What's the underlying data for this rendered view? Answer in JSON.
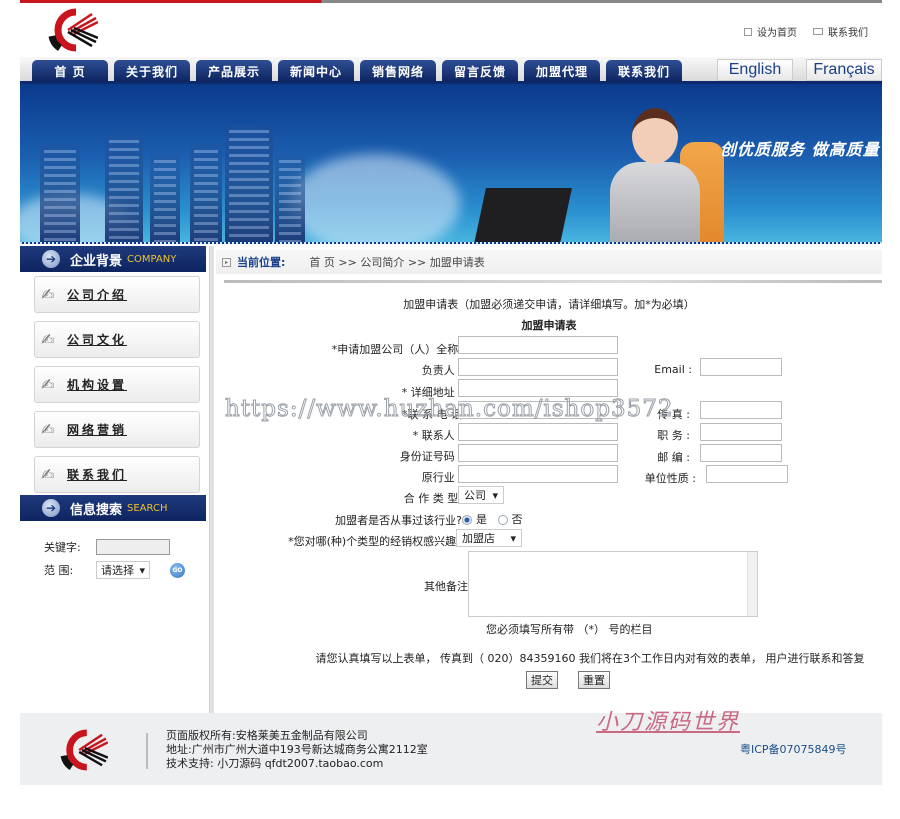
{
  "header": {
    "top_links": [
      {
        "label": "设为首页",
        "icon": "homepage-icon"
      },
      {
        "label": "联系我们",
        "icon": "mail-icon"
      }
    ],
    "nav": [
      "首 页",
      "关于我们",
      "产品展示",
      "新闻中心",
      "销售网络",
      "留言反馈",
      "加盟代理",
      "联系我们"
    ],
    "languages": [
      "English",
      "Français"
    ],
    "brand_colors": {
      "red": "#c8141c",
      "navy": "#0d2460"
    }
  },
  "banner": {
    "slogan": "创优质服务 做高质量"
  },
  "sidebar": {
    "company_section": {
      "title": "企业背景",
      "title_en": "COMPANY"
    },
    "menu": [
      "公司介绍",
      "公司文化",
      "机构设置",
      "网络营销",
      "联系我们"
    ],
    "search_section": {
      "title": "信息搜索",
      "title_en": "SEARCH",
      "keyword_label": "关键字:",
      "keyword_value": "",
      "scope_label": "范  围:",
      "scope_selected": "请选择",
      "go_label": "GO"
    }
  },
  "breadcrumb": {
    "label": "当前位置:",
    "path": "首 页 >> 公司简介 >> 加盟申请表"
  },
  "form": {
    "intro": "加盟申请表（加盟必须递交申请，请详细填写。加*为必填）",
    "title": "加盟申请表",
    "fields_left": [
      {
        "label": "*申请加盟公司（人）全称:",
        "value": ""
      },
      {
        "label": "负责人 :",
        "value": ""
      },
      {
        "label": "* 详细地址 :",
        "value": ""
      },
      {
        "label": "*联 系 电 话",
        "value": ""
      },
      {
        "label": "* 联系人 :",
        "value": ""
      },
      {
        "label": "身份证号码 :",
        "value": ""
      },
      {
        "label": "原行业 :",
        "value": ""
      }
    ],
    "fields_right": [
      {
        "label": "Email :",
        "value": ""
      },
      {
        "label": "传 真 :",
        "value": ""
      },
      {
        "label": "职 务 :",
        "value": ""
      },
      {
        "label": "邮 编 :",
        "value": ""
      },
      {
        "label": "单位性质 :",
        "value": ""
      }
    ],
    "coop_type": {
      "label": "合 作 类 型:",
      "selected": "公司"
    },
    "experience": {
      "label": "加盟者是否从事过该行业?",
      "options": [
        "是",
        "否"
      ],
      "selected": "是"
    },
    "interest": {
      "label": "*您对哪(种)个类型的经销权感兴趣?",
      "selected": "加盟店"
    },
    "remarks": {
      "label": "其他备注",
      "value": ""
    },
    "required_note": "您必须填写所有带 （*） 号的栏目",
    "fax_note": "请您认真填写以上表单， 传真到（ 020）84359160 我们将在3个工作日内对有效的表单， 用户进行联系和答复",
    "submit_label": "提交",
    "reset_label": "重置"
  },
  "watermark": "https://www.huzhan.com/ishop3572",
  "brand_watermark": "小刀源码世界",
  "footer": {
    "copyright": "页面版权所有:安格莱美五金制品有限公司",
    "address": "地址:广州市广州大道中193号新达城商务公寓2112室",
    "support": "技术支持: 小刀源码 qfdt2007.taobao.com",
    "icp": "粤ICP备07075849号"
  }
}
